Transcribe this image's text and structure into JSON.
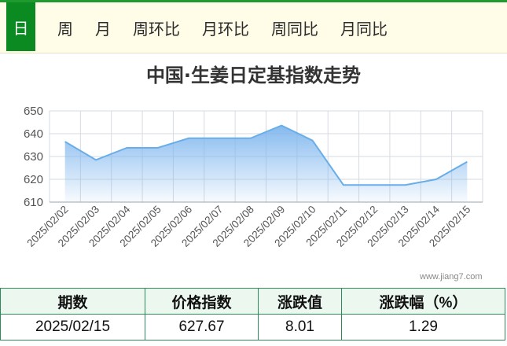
{
  "tabs": [
    "日",
    "周",
    "月",
    "周环比",
    "月环比",
    "周同比",
    "月同比"
  ],
  "active_tab": 0,
  "watermark": "www.jiang7.com",
  "table": {
    "headers": [
      "期数",
      "价格指数",
      "涨跌值",
      "涨跌幅（%）"
    ],
    "row": [
      "2025/02/15",
      "627.67",
      "8.01",
      "1.29"
    ]
  },
  "colors": {
    "accent": "#0b8a22",
    "line": "#6aaee8",
    "fill_top": "#7fb6ee",
    "table_border": "#2e8b57"
  },
  "chart_data": {
    "type": "area",
    "title": "中国·生姜日定基指数走势",
    "x": [
      "2025/02/02",
      "2025/02/03",
      "2025/02/04",
      "2025/02/05",
      "2025/02/06",
      "2025/02/07",
      "2025/02/08",
      "2025/02/09",
      "2025/02/10",
      "2025/02/11",
      "2025/02/12",
      "2025/02/13",
      "2025/02/14",
      "2025/02/15"
    ],
    "series": [
      {
        "values": [
          636.5,
          628.5,
          633.8,
          633.8,
          638.0,
          638.0,
          638.0,
          643.6,
          637.0,
          617.5,
          617.5,
          617.5,
          620.0,
          627.67
        ]
      }
    ],
    "ylim": [
      610,
      650
    ],
    "yticks": [
      610,
      620,
      630,
      640,
      650
    ],
    "grid": true,
    "xlabel": "",
    "ylabel": ""
  }
}
